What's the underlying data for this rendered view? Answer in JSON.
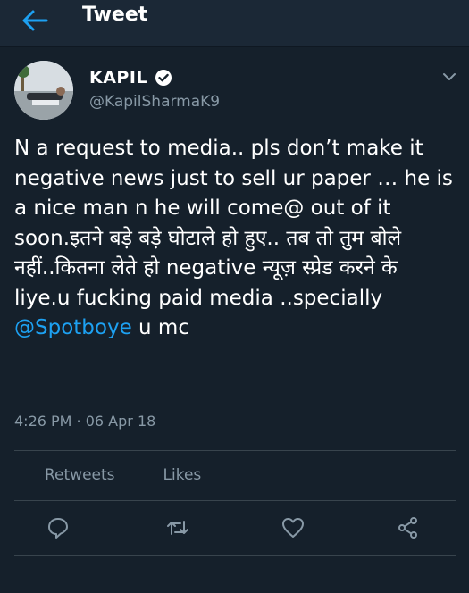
{
  "header": {
    "title": "Tweet",
    "back_icon": "arrow-left-icon"
  },
  "colors": {
    "background": "#15202b",
    "header": "#1b2836",
    "accent": "#1da1f2",
    "muted": "#8899a6"
  },
  "author": {
    "name": "KAPIL",
    "handle": "@KapilSharmaK9",
    "verified_icon": "verified-badge-icon",
    "menu_icon": "chevron-down-icon"
  },
  "tweet": {
    "text_before_mention": "N a request to media.. pls don’t make it negative news just to sell ur paper … he is a nice man n he will come@ out of it soon.इतने बड़े बड़े घोटाले हो हुए.. तब तो तुम बोले नहीं..कितना लेते हो negative न्यूज़ स्प्रेड करने के liye.u fucking paid media ..specially ",
    "mention": "@Spotboye",
    "text_after_mention": " u mc",
    "timestamp": "4:26 PM · 06 Apr 18"
  },
  "stats": {
    "retweets_count": "",
    "retweets_label": "Retweets",
    "likes_count": "",
    "likes_label": "Likes"
  },
  "actions": [
    "reply-icon",
    "retweet-icon",
    "like-icon",
    "share-icon"
  ]
}
